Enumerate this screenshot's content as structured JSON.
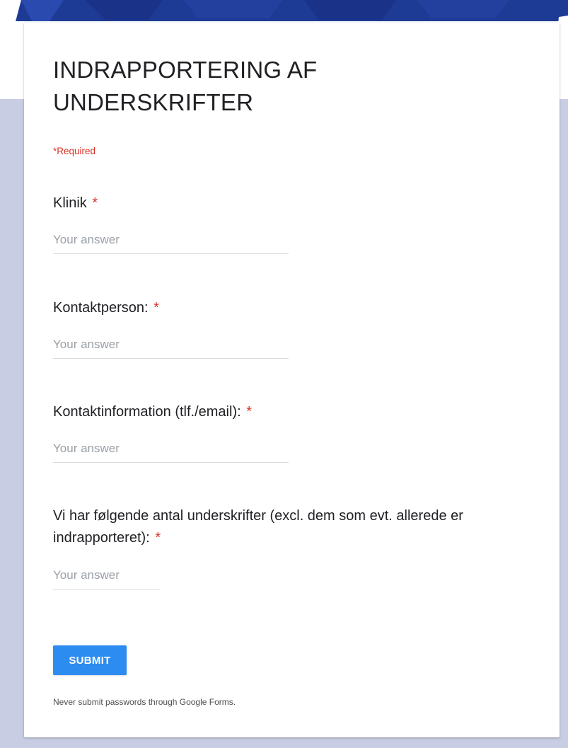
{
  "form": {
    "title": "INDRAPPORTERING AF UNDERSKRIFTER",
    "required_note": "*Required",
    "required_marker": "*",
    "questions": [
      {
        "label": "Klinik",
        "placeholder": "Your answer"
      },
      {
        "label": "Kontaktperson:",
        "placeholder": "Your answer"
      },
      {
        "label": "Kontaktinformation (tlf./email):",
        "placeholder": "Your answer"
      },
      {
        "label": "Vi har følgende antal underskrifter (excl. dem som evt. allerede er indrapporteret):",
        "placeholder": "Your answer"
      }
    ],
    "submit_label": "SUBMIT",
    "footer_note": "Never submit passwords through Google Forms."
  },
  "colors": {
    "page_background": "#c8cde3",
    "accent": "#2d8cf0",
    "required": "#d93025",
    "banner": "#1d3a94"
  }
}
